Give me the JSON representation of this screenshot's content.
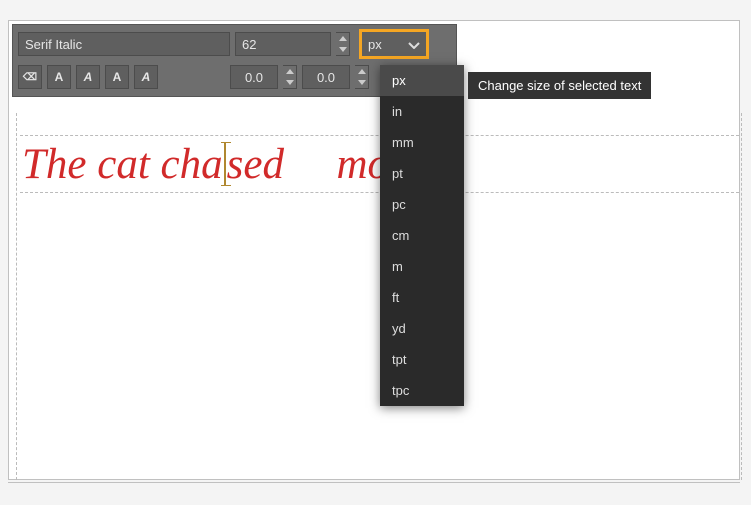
{
  "toolbar": {
    "font_family": "Serif Italic",
    "font_size": "62",
    "unit_selected": "px",
    "letter_spacing": "0.0",
    "word_spacing": "0.0",
    "style_buttons": {
      "normal": "A",
      "bold": "A",
      "italic": "A",
      "bold_italic": "A"
    }
  },
  "unit_dropdown": {
    "options": [
      "px",
      "in",
      "mm",
      "pt",
      "pc",
      "cm",
      "m",
      "ft",
      "yd",
      "tpt",
      "tpc"
    ],
    "selected": "px"
  },
  "tooltip": "Change size of selected text",
  "canvas": {
    "text_before": "The cat cha",
    "text_mid": "sed ",
    "text_after": " mouse."
  }
}
